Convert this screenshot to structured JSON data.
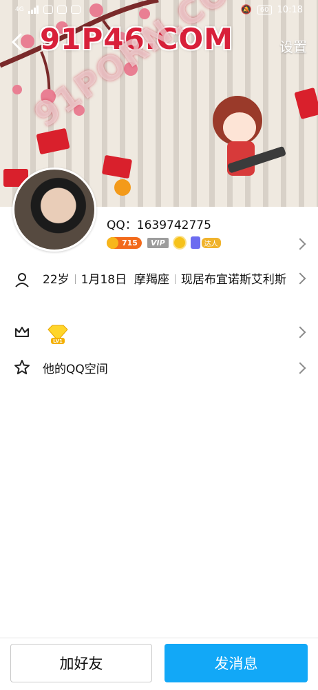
{
  "statusbar": {
    "network": "4G",
    "battery": "60",
    "time": "10:18"
  },
  "header": {
    "settings_label": "设置",
    "watermark": "91P46.COM",
    "watermark2": "91PORN.COM"
  },
  "profile": {
    "qq_label": "QQ：1639742775",
    "coin_count": "715",
    "vip_label": "VIP",
    "daren_label": "达人"
  },
  "info": {
    "age": "22岁",
    "birthday": "1月18日",
    "zodiac": "摩羯座",
    "location": "现居布宜诺斯艾利斯"
  },
  "level": {
    "badge": "LV1"
  },
  "qzone": {
    "label": "他的QQ空间"
  },
  "actions": {
    "add_friend": "加好友",
    "send_message": "发消息"
  },
  "colors": {
    "primary_button": "#12a8f7",
    "coin": "#f26a1b"
  }
}
